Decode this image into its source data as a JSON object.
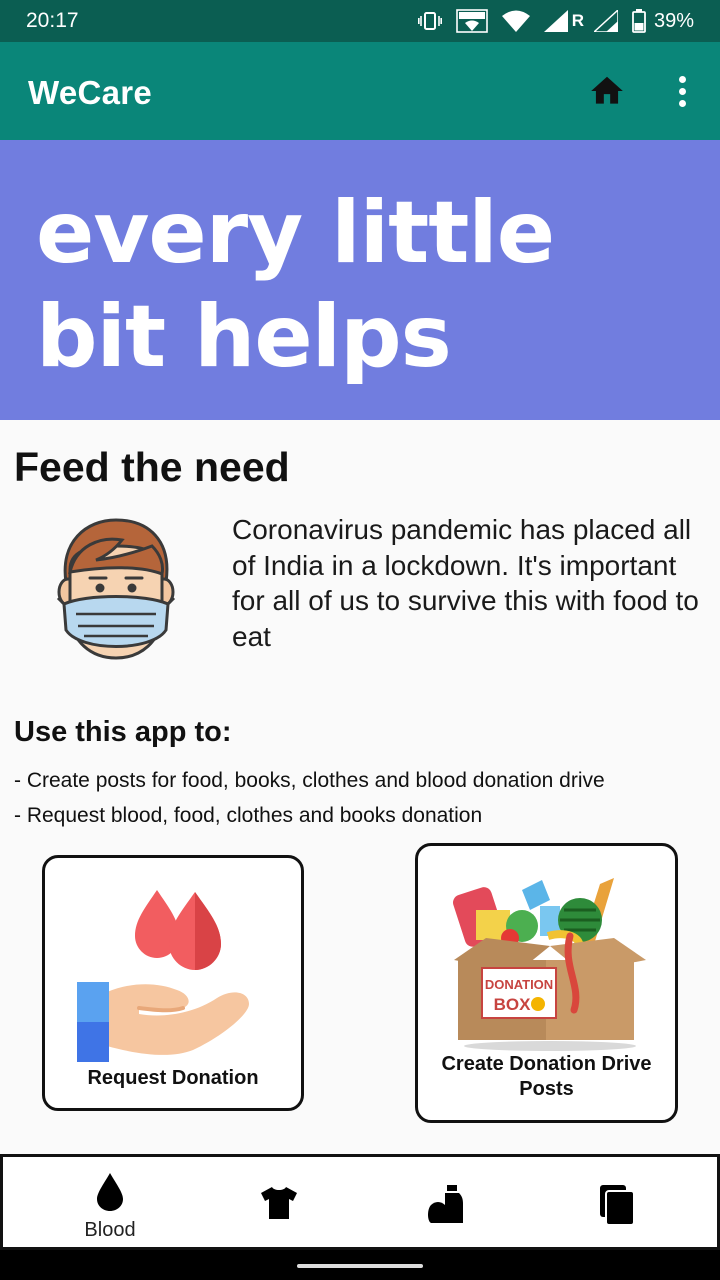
{
  "status_bar": {
    "time": "20:17",
    "network_indicator": "R",
    "battery": "39%",
    "vowifi_label": "VoWiFi"
  },
  "app_bar": {
    "title": "WeCare",
    "actions": [
      "home-icon",
      "more-vert-icon"
    ]
  },
  "banner": {
    "line1": "every little",
    "line2": "bit helps",
    "background": "#717ddf"
  },
  "feed": {
    "title": "Feed the need",
    "text": "Coronavirus pandemic has placed all of India in a lockdown. It's important for all of us to survive this with food to eat"
  },
  "use_app": {
    "title": "Use this app to:",
    "items": [
      "- Create posts for food, books, clothes and blood donation drive",
      "- Request blood, food, clothes and books donation"
    ]
  },
  "cards": {
    "request": {
      "label": "Request Donation"
    },
    "create": {
      "label": "Create Donation Drive Posts",
      "box_text_top": "DONATION",
      "box_text_bottom": "BOX"
    }
  },
  "bottom_nav": {
    "items": [
      {
        "label": "Blood",
        "icon": "blood-drop-icon",
        "active": true
      },
      {
        "label": "",
        "icon": "shirt-icon"
      },
      {
        "label": "",
        "icon": "food-icon"
      },
      {
        "label": "",
        "icon": "books-icon"
      }
    ]
  },
  "colors": {
    "status_bar": "#0b5e52",
    "app_bar": "#0a8679",
    "banner": "#717ddf"
  }
}
